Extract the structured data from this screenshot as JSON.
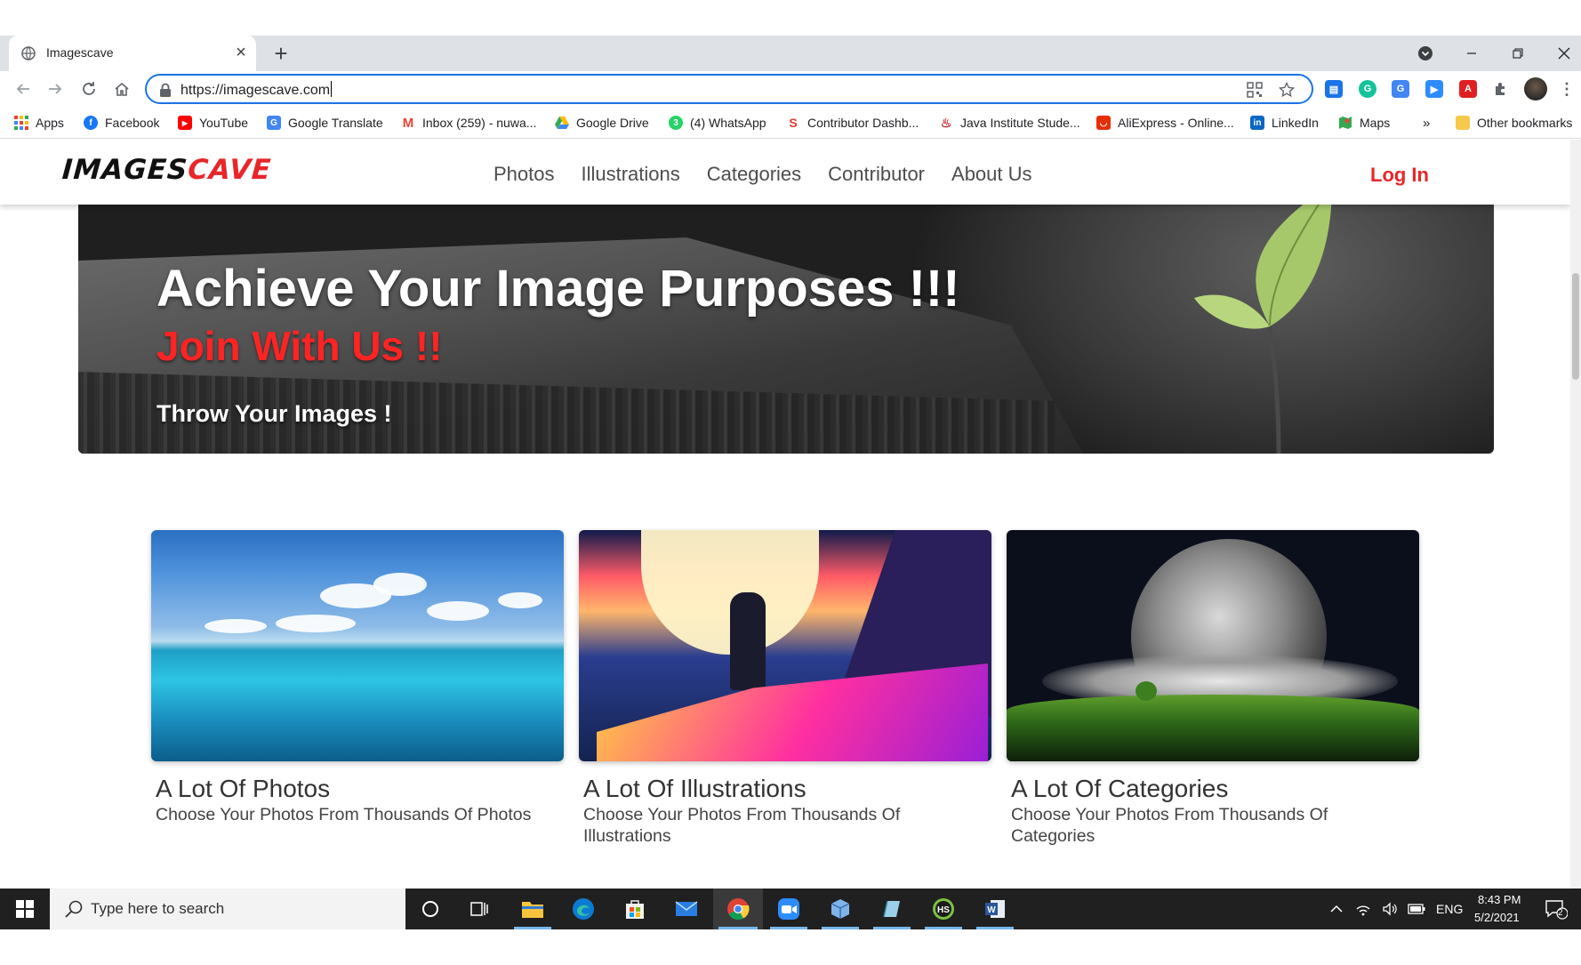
{
  "browser": {
    "tab_title": "Imagescave",
    "url": "https://imagescave.com",
    "bookmarks": [
      {
        "label": "Apps",
        "icon": "apps-grid-icon",
        "color": "#ea4335"
      },
      {
        "label": "Facebook",
        "icon": "facebook-icon",
        "color": "#1877f2"
      },
      {
        "label": "YouTube",
        "icon": "youtube-icon",
        "color": "#ff0000"
      },
      {
        "label": "Google Translate",
        "icon": "google-translate-icon",
        "color": "#4285f4"
      },
      {
        "label": "Inbox (259) - nuwa...",
        "icon": "gmail-icon",
        "color": "#ea4335"
      },
      {
        "label": "Google Drive",
        "icon": "google-drive-icon",
        "color": "#34a853"
      },
      {
        "label": "(4) WhatsApp",
        "icon": "whatsapp-icon",
        "color": "#25d366"
      },
      {
        "label": "Contributor Dashb...",
        "icon": "contributor-icon",
        "color": "#e53935"
      },
      {
        "label": "Java Institute Stude...",
        "icon": "java-institute-icon",
        "color": "#c62828"
      },
      {
        "label": "AliExpress - Online...",
        "icon": "aliexpress-icon",
        "color": "#e62e04"
      },
      {
        "label": "LinkedIn",
        "icon": "linkedin-icon",
        "color": "#0a66c2"
      },
      {
        "label": "Maps",
        "icon": "maps-icon",
        "color": "#34a853"
      }
    ],
    "more_bookmarks": "»",
    "other_bookmarks": "Other bookmarks"
  },
  "site": {
    "logo_part1": "IMAGES",
    "logo_part2": "CAVE",
    "nav": [
      "Photos",
      "Illustrations",
      "Categories",
      "Contributor",
      "About Us"
    ],
    "login": "Log In",
    "hero": {
      "title": "Achieve Your Image Purposes !!!",
      "subtitle": "Join With Us !!",
      "tagline": "Throw Your Images !"
    },
    "cards": [
      {
        "title": "A Lot Of Photos",
        "text": "Choose Your Photos From Thousands Of Photos"
      },
      {
        "title": "A Lot Of Illustrations",
        "text": "Choose Your Photos From Thousands Of Illustrations"
      },
      {
        "title": "A Lot Of Categories",
        "text": "Choose Your Photos From Thousands Of Categories"
      }
    ],
    "accent_color": "#e8262a"
  },
  "taskbar": {
    "search_placeholder": "Type here to search",
    "language": "ENG",
    "time": "8:43 PM",
    "date": "5/2/2021",
    "notification_count": "2"
  }
}
